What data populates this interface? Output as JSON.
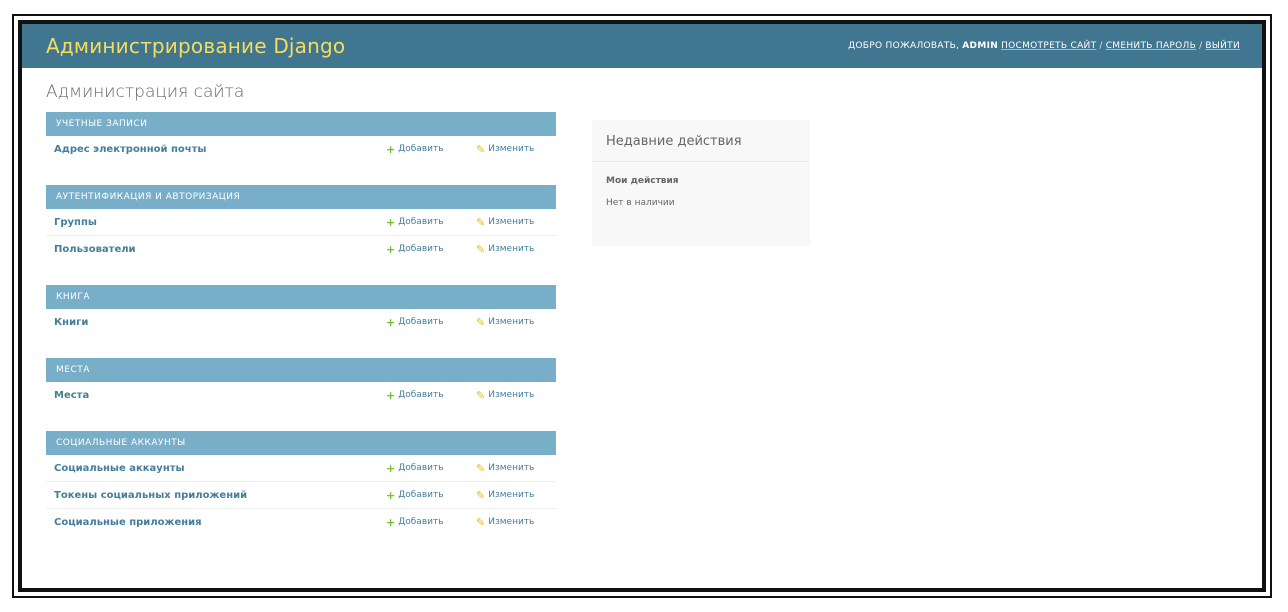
{
  "header": {
    "brand": "Администрирование Django",
    "welcome": "Добро пожаловать,",
    "username": "admin",
    "links": {
      "view_site": "Посмотреть сайт",
      "change_password": "Сменить пароль",
      "logout": "Выйти"
    },
    "separator": "/"
  },
  "page_title": "Администрация сайта",
  "actions": {
    "add_label": "Добавить",
    "change_label": "Изменить"
  },
  "apps": [
    {
      "name": "Учетные записи",
      "models": [
        "Адрес электронной почты"
      ]
    },
    {
      "name": "Аутентификация и авторизация",
      "models": [
        "Группы",
        "Пользователи"
      ]
    },
    {
      "name": "Книга",
      "models": [
        "Книги"
      ]
    },
    {
      "name": "Места",
      "models": [
        "Места"
      ]
    },
    {
      "name": "Социальные аккаунты",
      "models": [
        "Социальные аккаунты",
        "Токены социальных приложений",
        "Социальные приложения"
      ]
    }
  ],
  "recent_actions": {
    "title": "Недавние действия",
    "my_actions": "Мои действия",
    "empty": "Нет в наличии"
  },
  "colors": {
    "header_bg": "#417690",
    "brand": "#f5dd5d",
    "caption_bg": "#79aec8",
    "link": "#447e9b",
    "add_icon": "#70bf2b",
    "change_icon": "#efb80b"
  },
  "icons": {
    "add": "plus-icon",
    "change": "pencil-icon"
  }
}
